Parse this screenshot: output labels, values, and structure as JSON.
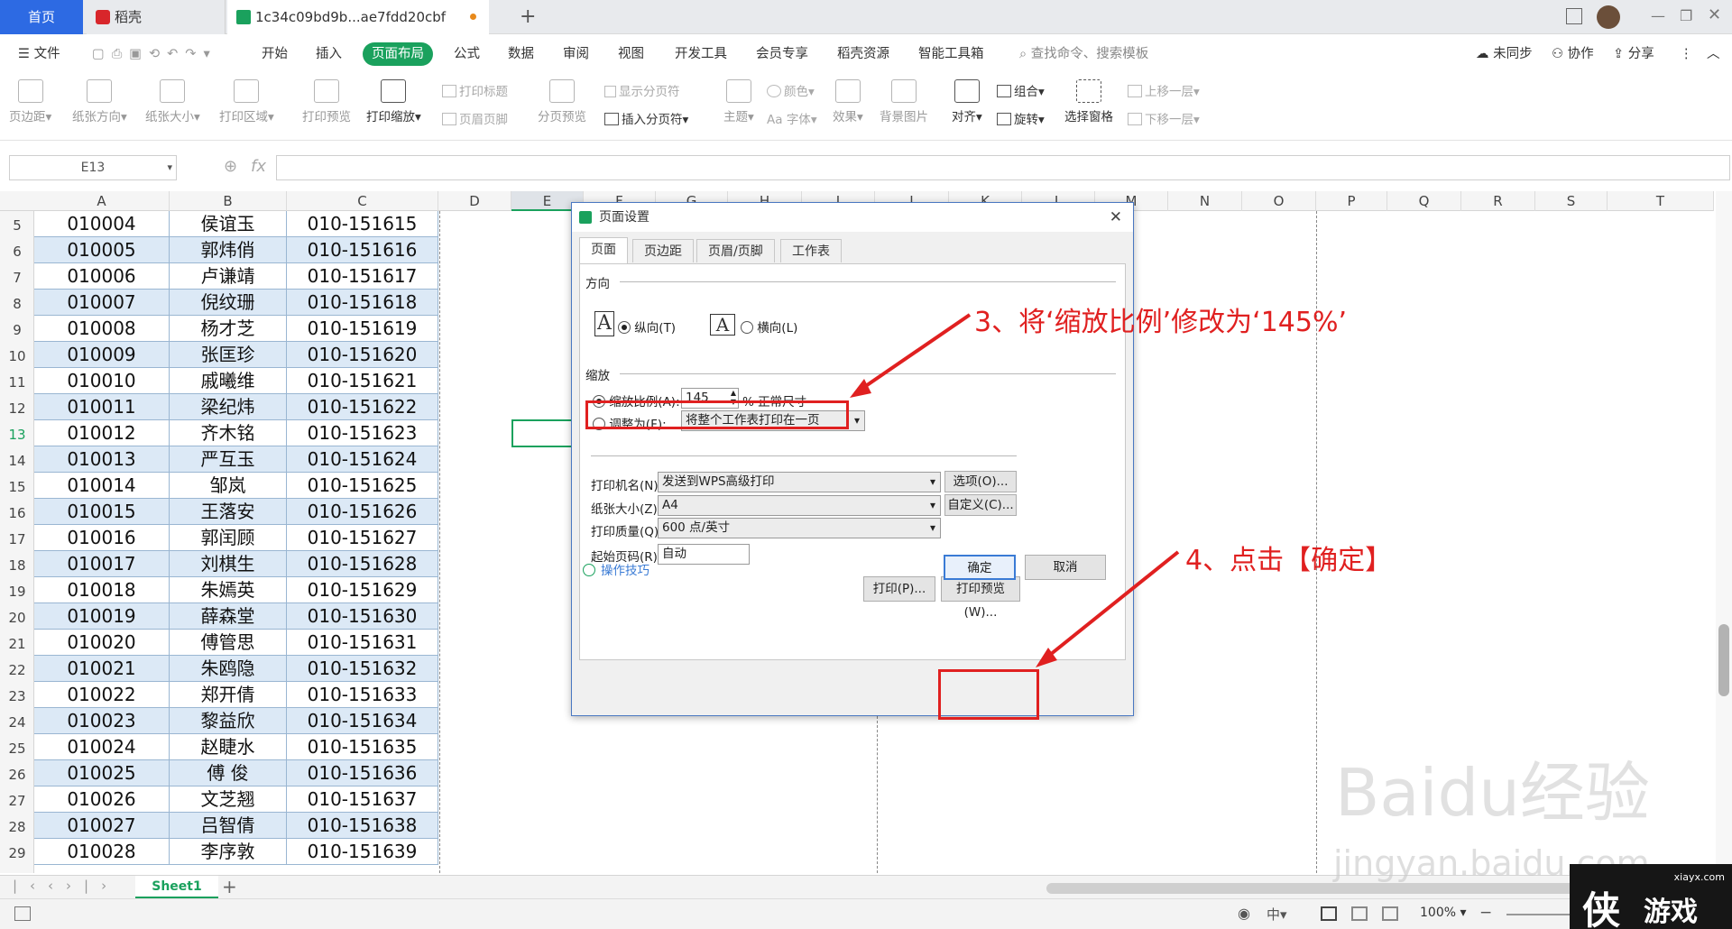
{
  "tabs": {
    "home": "首页",
    "daoke": "稻壳",
    "file": "1c34c09bd9b...ae7fdd20cbf",
    "new_tab": "+"
  },
  "menu": {
    "file": "文件",
    "items": [
      "开始",
      "插入",
      "页面布局",
      "公式",
      "数据",
      "审阅",
      "视图",
      "开发工具",
      "会员专享",
      "稻壳资源",
      "智能工具箱"
    ],
    "search": "查找命令、搜索模板",
    "sync": "未同步",
    "collab": "协作",
    "share": "分享"
  },
  "toolbar": {
    "margin": "页边距",
    "orientation": "纸张方向",
    "size": "纸张大小",
    "print_area": "打印区域",
    "print_preview": "打印预览",
    "print_scale": "打印缩放",
    "print_title": "打印标题",
    "header_footer": "页眉页脚",
    "page_break_preview": "分页预览",
    "show_page_break": "显示分页符",
    "insert_page_break": "插入分页符",
    "theme": "主题",
    "color": "颜色",
    "font": "字体",
    "effect": "效果",
    "background": "背景图片",
    "align": "对齐",
    "group": "组合",
    "rotate": "旋转",
    "selection_pane": "选择窗格",
    "bring_forward": "上移一层",
    "send_backward": "下移一层"
  },
  "formula": {
    "cell_ref": "E13",
    "fx": "fx"
  },
  "columns": [
    "A",
    "B",
    "C",
    "D",
    "E",
    "F",
    "G",
    "H",
    "I",
    "J",
    "K",
    "L",
    "M",
    "N",
    "O",
    "P",
    "Q",
    "R",
    "S",
    "T"
  ],
  "rows": [
    {
      "n": "5",
      "a": "010004",
      "b": "侯谊玉",
      "c": "010-151615"
    },
    {
      "n": "6",
      "a": "010005",
      "b": "郭炜俏",
      "c": "010-151616"
    },
    {
      "n": "7",
      "a": "010006",
      "b": "卢谦靖",
      "c": "010-151617"
    },
    {
      "n": "8",
      "a": "010007",
      "b": "倪纹珊",
      "c": "010-151618"
    },
    {
      "n": "9",
      "a": "010008",
      "b": "杨才芝",
      "c": "010-151619"
    },
    {
      "n": "10",
      "a": "010009",
      "b": "张匡珍",
      "c": "010-151620"
    },
    {
      "n": "11",
      "a": "010010",
      "b": "戚曦维",
      "c": "010-151621"
    },
    {
      "n": "12",
      "a": "010011",
      "b": "梁纪炜",
      "c": "010-151622"
    },
    {
      "n": "13",
      "a": "010012",
      "b": "齐木铭",
      "c": "010-151623"
    },
    {
      "n": "14",
      "a": "010013",
      "b": "严互玉",
      "c": "010-151624"
    },
    {
      "n": "15",
      "a": "010014",
      "b": "邹岚",
      "c": "010-151625"
    },
    {
      "n": "16",
      "a": "010015",
      "b": "王落安",
      "c": "010-151626"
    },
    {
      "n": "17",
      "a": "010016",
      "b": "郭闰顾",
      "c": "010-151627"
    },
    {
      "n": "18",
      "a": "010017",
      "b": "刘棋生",
      "c": "010-151628"
    },
    {
      "n": "19",
      "a": "010018",
      "b": "朱嫣英",
      "c": "010-151629"
    },
    {
      "n": "20",
      "a": "010019",
      "b": "薛森堂",
      "c": "010-151630"
    },
    {
      "n": "21",
      "a": "010020",
      "b": "傅管思",
      "c": "010-151631"
    },
    {
      "n": "22",
      "a": "010021",
      "b": "朱鸥隐",
      "c": "010-151632"
    },
    {
      "n": "23",
      "a": "010022",
      "b": "郑开倩",
      "c": "010-151633"
    },
    {
      "n": "24",
      "a": "010023",
      "b": "黎益欣",
      "c": "010-151634"
    },
    {
      "n": "25",
      "a": "010024",
      "b": "赵睫水",
      "c": "010-151635"
    },
    {
      "n": "26",
      "a": "010025",
      "b": "傅 俊",
      "c": "010-151636"
    },
    {
      "n": "27",
      "a": "010026",
      "b": "文芝翘",
      "c": "010-151637"
    },
    {
      "n": "28",
      "a": "010027",
      "b": "吕智倩",
      "c": "010-151638"
    },
    {
      "n": "29",
      "a": "010028",
      "b": "李序敦",
      "c": "010-151639"
    }
  ],
  "sheet": {
    "tab": "Sheet1",
    "add": "+"
  },
  "status": {
    "zoom": "100%"
  },
  "dialog": {
    "title": "页面设置",
    "tabs": [
      "页面",
      "页边距",
      "页眉/页脚",
      "工作表"
    ],
    "orientation_label": "方向",
    "portrait": "纵向(T)",
    "landscape": "横向(L)",
    "scale_label": "缩放",
    "scale_ratio": "缩放比例(A):",
    "scale_value": "145",
    "scale_suffix": "% 正常尺寸",
    "fit_to": "调整为(F):",
    "fit_option": "将整个工作表打印在一页",
    "printer_label": "打印机名(N)",
    "printer_value": "发送到WPS高级打印",
    "options_btn": "选项(O)...",
    "paper_label": "纸张大小(Z):",
    "paper_value": "A4",
    "custom_btn": "自定义(C)...",
    "quality_label": "打印质量(Q):",
    "quality_value": "600 点/英寸",
    "start_page_label": "起始页码(R):",
    "start_page_value": "自动",
    "print_btn": "打印(P)...",
    "preview_btn": "打印预览(W)...",
    "tips": "操作技巧",
    "ok": "确定",
    "cancel": "取消"
  },
  "annotations": {
    "step3": "3、将‘缩放比例’修改为‘145%’",
    "step4": "4、点击【确定】"
  },
  "watermark": {
    "brand": "Baidu经验",
    "url": "jingyan.baidu.com",
    "logo_text": "游戏",
    "logo_url": "xiayx.com"
  },
  "colors": {
    "accent_green": "#1aa15d",
    "home_tab": "#2d6ae3",
    "annotation_red": "#e02020",
    "row_alt": "#dce9f6"
  }
}
